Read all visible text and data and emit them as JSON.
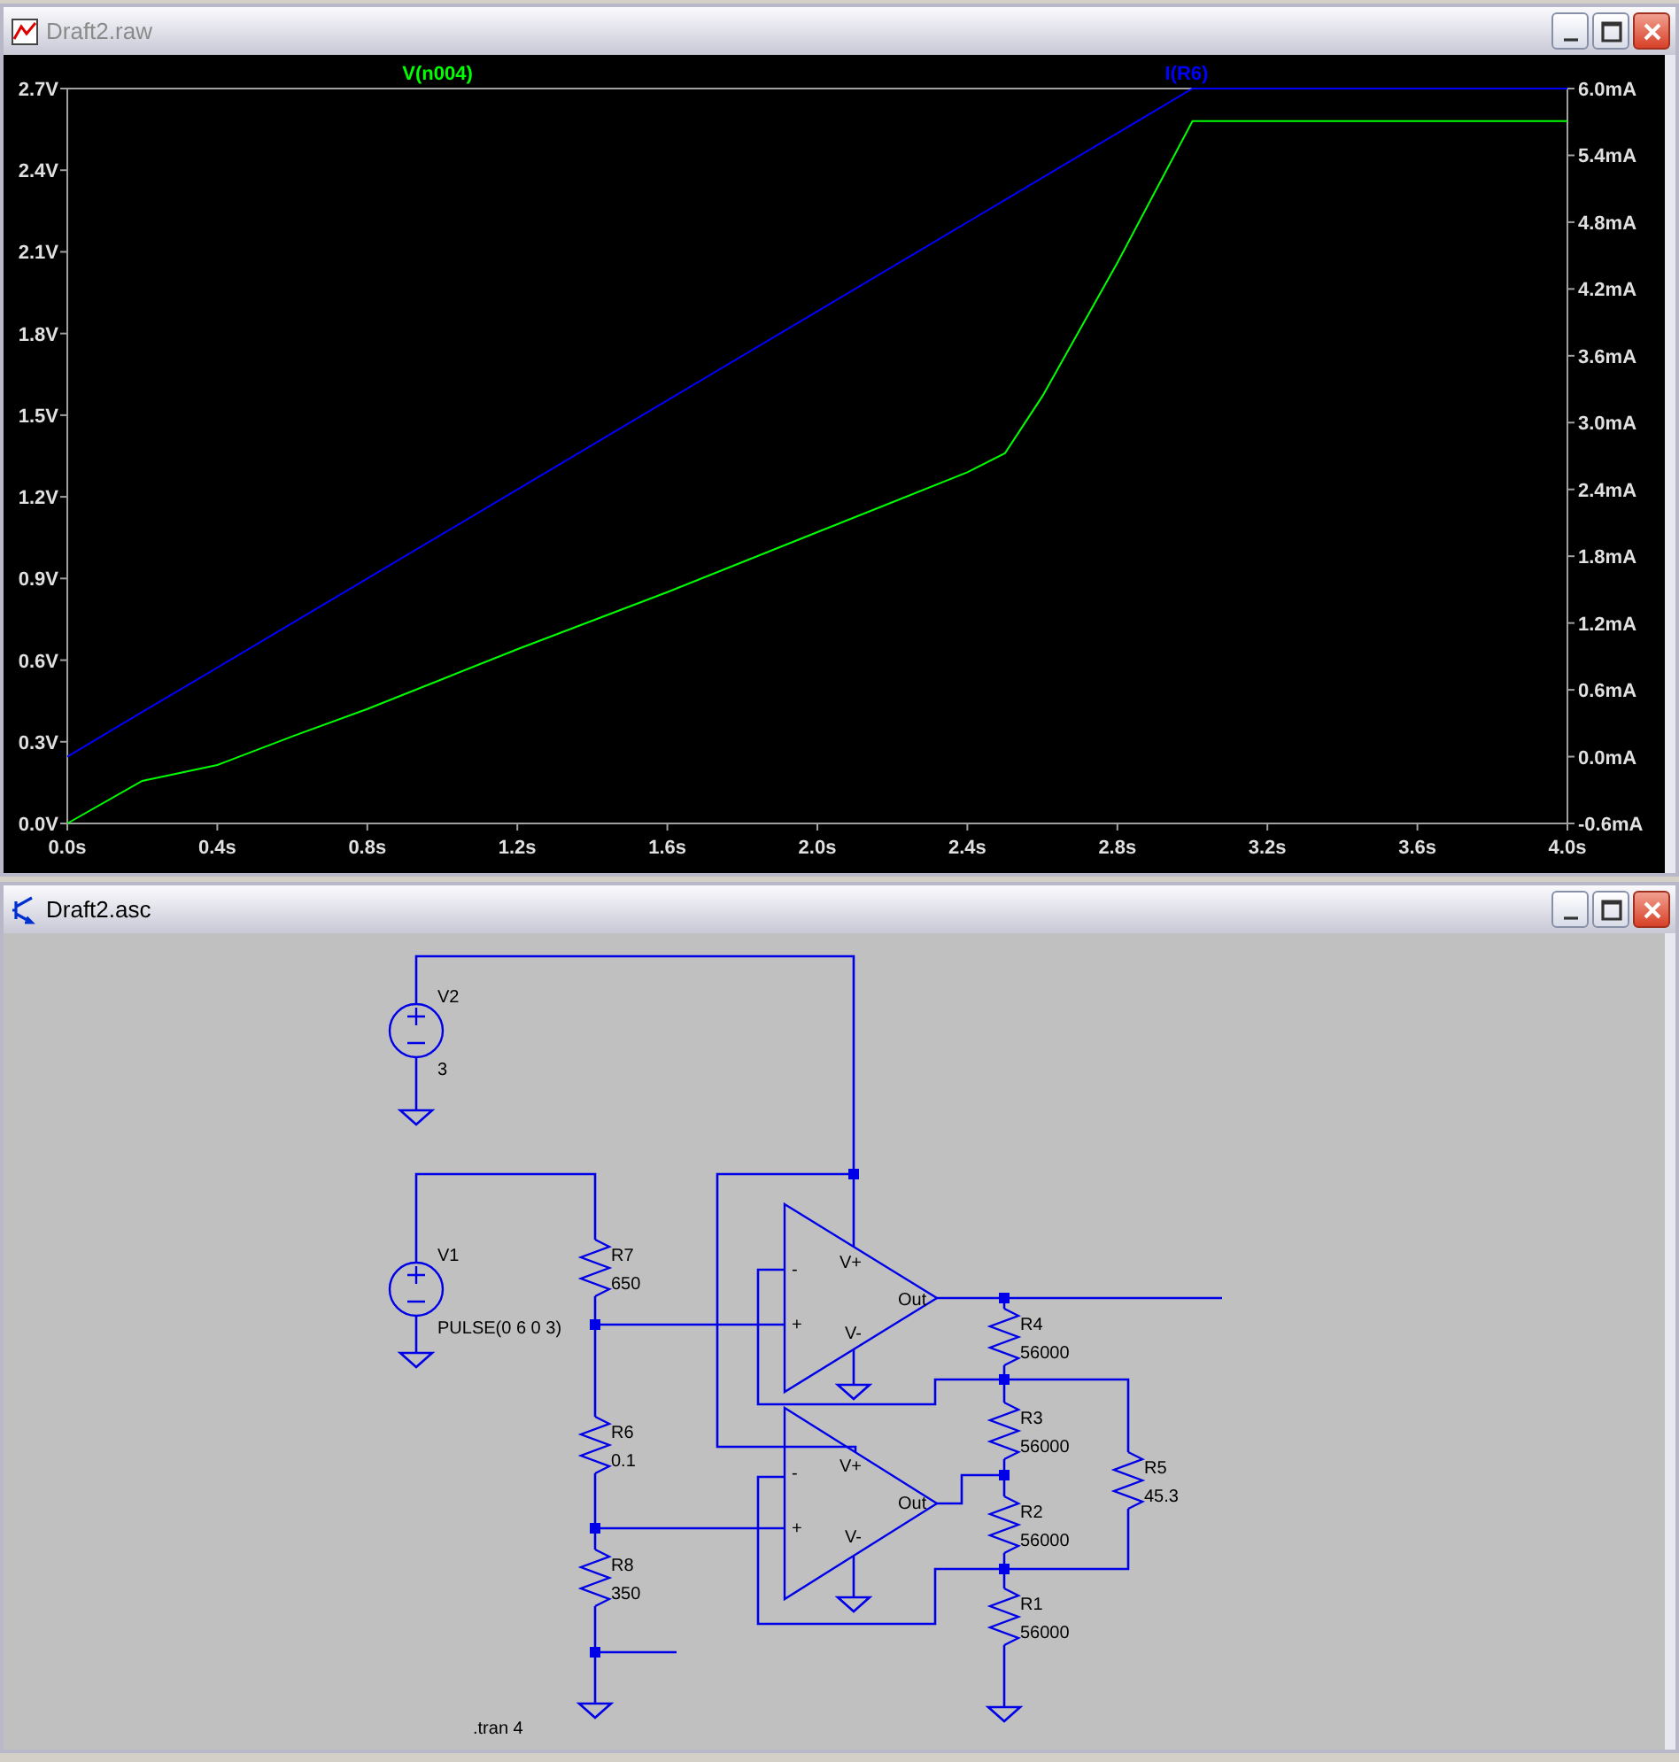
{
  "waveform_window": {
    "title": "Draft2.raw",
    "active": false,
    "chart_data": {
      "type": "line",
      "xlim": [
        0,
        4
      ],
      "ylim": [
        0,
        2.7
      ],
      "y2lim": [
        -0.6,
        6.0
      ],
      "x": [
        0,
        0.2,
        0.4,
        0.6,
        0.8,
        1.2,
        1.6,
        2.0,
        2.4,
        2.5,
        2.6,
        2.8,
        3.0,
        3.2,
        3.6,
        4.0
      ],
      "series": [
        {
          "name": "V(n004)",
          "color": "#00ff00",
          "values": [
            0,
            0.156,
            0.215,
            0.32,
            0.42,
            0.64,
            0.85,
            1.07,
            1.29,
            1.36,
            1.57,
            2.06,
            2.58,
            2.58,
            2.58,
            2.58
          ]
        },
        {
          "name": "I(R6)",
          "color": "#0000ff",
          "axis": "y2",
          "values": [
            0,
            0.4,
            0.8,
            1.2,
            1.6,
            2.4,
            3.2,
            4.0,
            4.8,
            5.0,
            5.2,
            5.6,
            6.0,
            6.0,
            6.0,
            6.0
          ]
        }
      ],
      "xticks": [
        {
          "value": 0,
          "label": "0.0s"
        },
        {
          "value": 0.4,
          "label": "0.4s"
        },
        {
          "value": 0.8,
          "label": "0.8s"
        },
        {
          "value": 1.2,
          "label": "1.2s"
        },
        {
          "value": 1.6,
          "label": "1.6s"
        },
        {
          "value": 2.0,
          "label": "2.0s"
        },
        {
          "value": 2.4,
          "label": "2.4s"
        },
        {
          "value": 2.8,
          "label": "2.8s"
        },
        {
          "value": 3.2,
          "label": "3.2s"
        },
        {
          "value": 3.6,
          "label": "3.6s"
        },
        {
          "value": 4.0,
          "label": "4.0s"
        }
      ],
      "yticks": [
        {
          "value": 0,
          "label": "0.0V"
        },
        {
          "value": 0.3,
          "label": "0.3V"
        },
        {
          "value": 0.6,
          "label": "0.6V"
        },
        {
          "value": 0.9,
          "label": "0.9V"
        },
        {
          "value": 1.2,
          "label": "1.2V"
        },
        {
          "value": 1.5,
          "label": "1.5V"
        },
        {
          "value": 1.8,
          "label": "1.8V"
        },
        {
          "value": 2.1,
          "label": "2.1V"
        },
        {
          "value": 2.4,
          "label": "2.4V"
        },
        {
          "value": 2.7,
          "label": "2.7V"
        }
      ],
      "y2ticks": [
        {
          "value": -0.6,
          "label": "-0.6mA"
        },
        {
          "value": 0,
          "label": "0.0mA"
        },
        {
          "value": 0.6,
          "label": "0.6mA"
        },
        {
          "value": 1.2,
          "label": "1.2mA"
        },
        {
          "value": 1.8,
          "label": "1.8mA"
        },
        {
          "value": 2.4,
          "label": "2.4mA"
        },
        {
          "value": 3.0,
          "label": "3.0mA"
        },
        {
          "value": 3.6,
          "label": "3.6mA"
        },
        {
          "value": 4.2,
          "label": "4.2mA"
        },
        {
          "value": 4.8,
          "label": "4.8mA"
        },
        {
          "value": 5.4,
          "label": "5.4mA"
        },
        {
          "value": 6.0,
          "label": "6.0mA"
        }
      ]
    }
  },
  "schematic_window": {
    "title": "Draft2.asc",
    "active": true,
    "components": [
      {
        "kind": "voltage_source",
        "ref": "V2",
        "value": "3"
      },
      {
        "kind": "voltage_source",
        "ref": "V1",
        "value": "PULSE(0 6 0 3)"
      },
      {
        "kind": "resistor",
        "ref": "R7",
        "value": "650"
      },
      {
        "kind": "resistor",
        "ref": "R6",
        "value": "0.1"
      },
      {
        "kind": "resistor",
        "ref": "R8",
        "value": "350"
      },
      {
        "kind": "opamp",
        "pins": [
          "-",
          "+",
          "V+",
          "V-",
          "Out"
        ]
      },
      {
        "kind": "opamp",
        "pins": [
          "-",
          "+",
          "V+",
          "V-",
          "Out"
        ]
      },
      {
        "kind": "resistor",
        "ref": "R4",
        "value": "56000"
      },
      {
        "kind": "resistor",
        "ref": "R3",
        "value": "56000"
      },
      {
        "kind": "resistor",
        "ref": "R2",
        "value": "56000"
      },
      {
        "kind": "resistor",
        "ref": "R1",
        "value": "56000"
      },
      {
        "kind": "resistor",
        "ref": "R5",
        "value": "45.3"
      }
    ],
    "directive": ".tran 4"
  }
}
